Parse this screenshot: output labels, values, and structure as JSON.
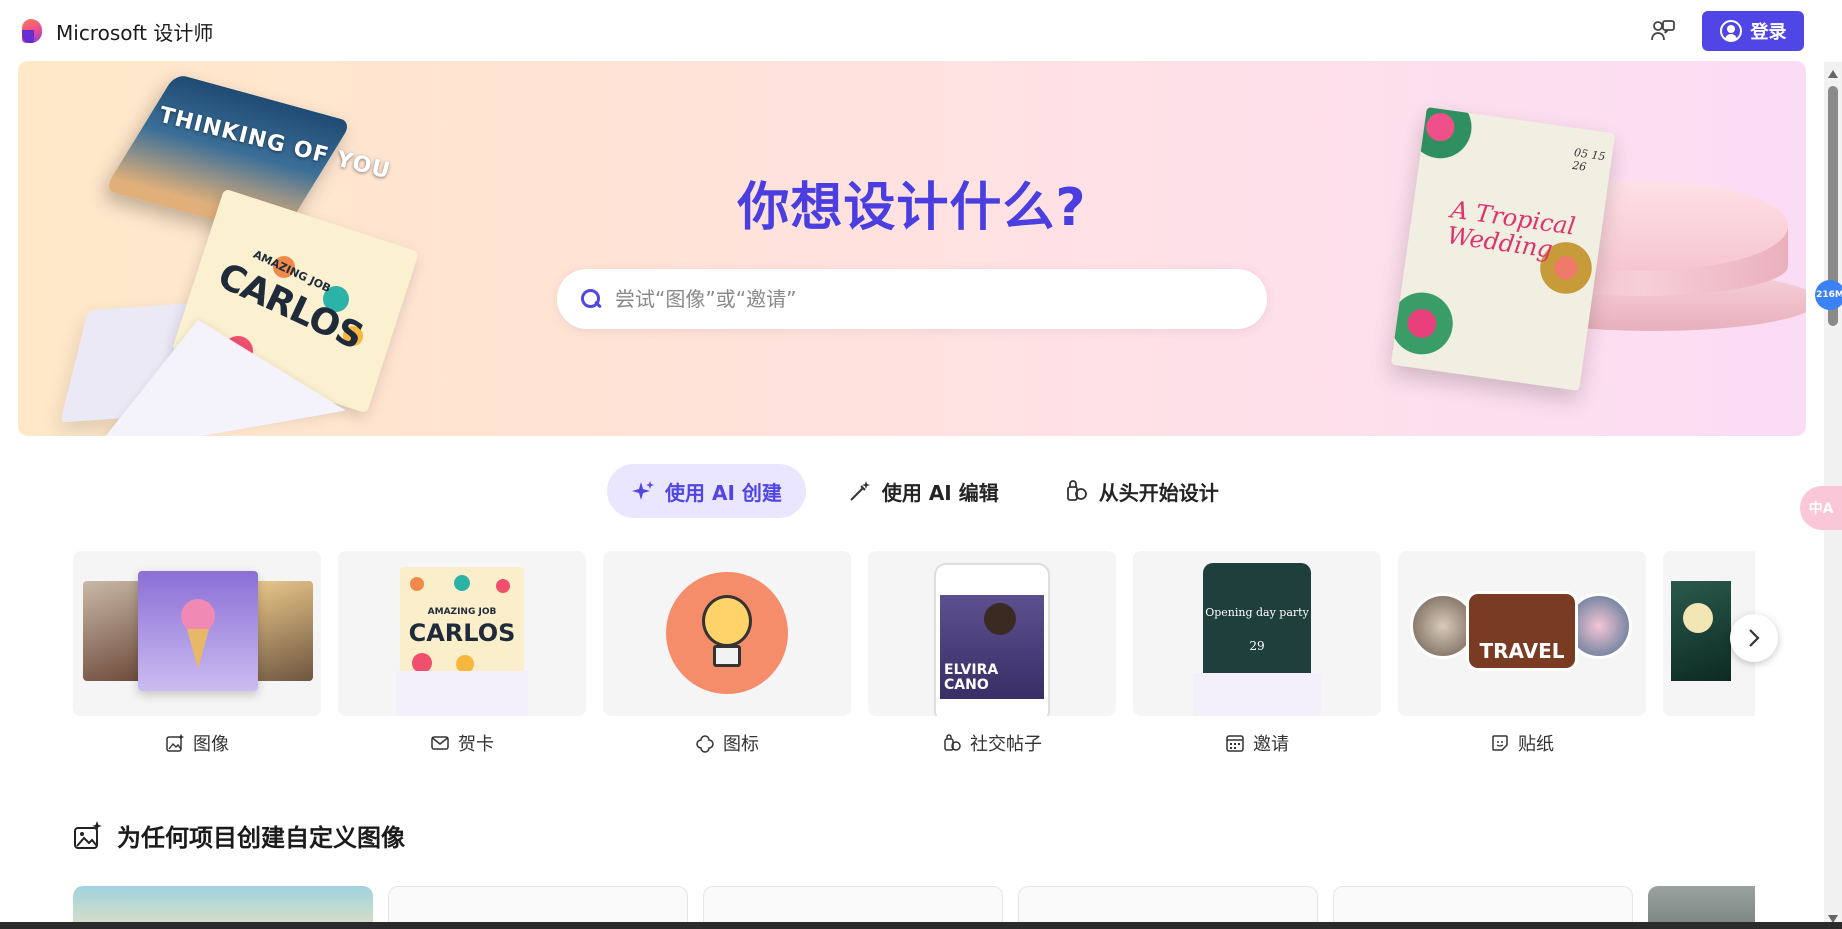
{
  "header": {
    "brand": "Microsoft 设计师",
    "signin_label": "登录",
    "accent_color": "#4f46e5"
  },
  "hero": {
    "title": "你想设计什么?",
    "search_placeholder": "尝试“图像”或“邀请”",
    "art": {
      "thinking_card_text": "THINKING OF YOU",
      "carlos_card_text": "CARLOS",
      "carlos_card_subtext": "AMAZING JOB",
      "wedding_card_title": "A Tropical Wedding",
      "wedding_card_date": "05 15 26"
    }
  },
  "tabs": [
    {
      "label": "使用 AI 创建",
      "icon": "sparkle-icon",
      "active": true
    },
    {
      "label": "使用 AI 编辑",
      "icon": "magic-wand-icon",
      "active": false
    },
    {
      "label": "从头开始设计",
      "icon": "shapes-icon",
      "active": false
    }
  ],
  "categories": [
    {
      "label": "图像",
      "icon": "image-sparkle-icon"
    },
    {
      "label": "贺卡",
      "icon": "envelope-icon"
    },
    {
      "label": "图标",
      "icon": "icon-shape-icon"
    },
    {
      "label": "社交帖子",
      "icon": "social-post-icon"
    },
    {
      "label": "邀请",
      "icon": "calendar-icon"
    },
    {
      "label": "贴纸",
      "icon": "sticker-icon"
    }
  ],
  "category_art": {
    "social_post_name": "ELVIRA CANO",
    "invite_text": "Opening day party",
    "invite_date": "29",
    "sticker_text": "TRAVEL",
    "greeting_card_text": "CARLOS",
    "greeting_card_subtext": "AMAZING JOB"
  },
  "section": {
    "title": "为任何项目创建自定义图像",
    "icon": "image-sparkle-icon"
  },
  "widgets": {
    "memory_badge": "216M",
    "translate_label": "中A"
  }
}
